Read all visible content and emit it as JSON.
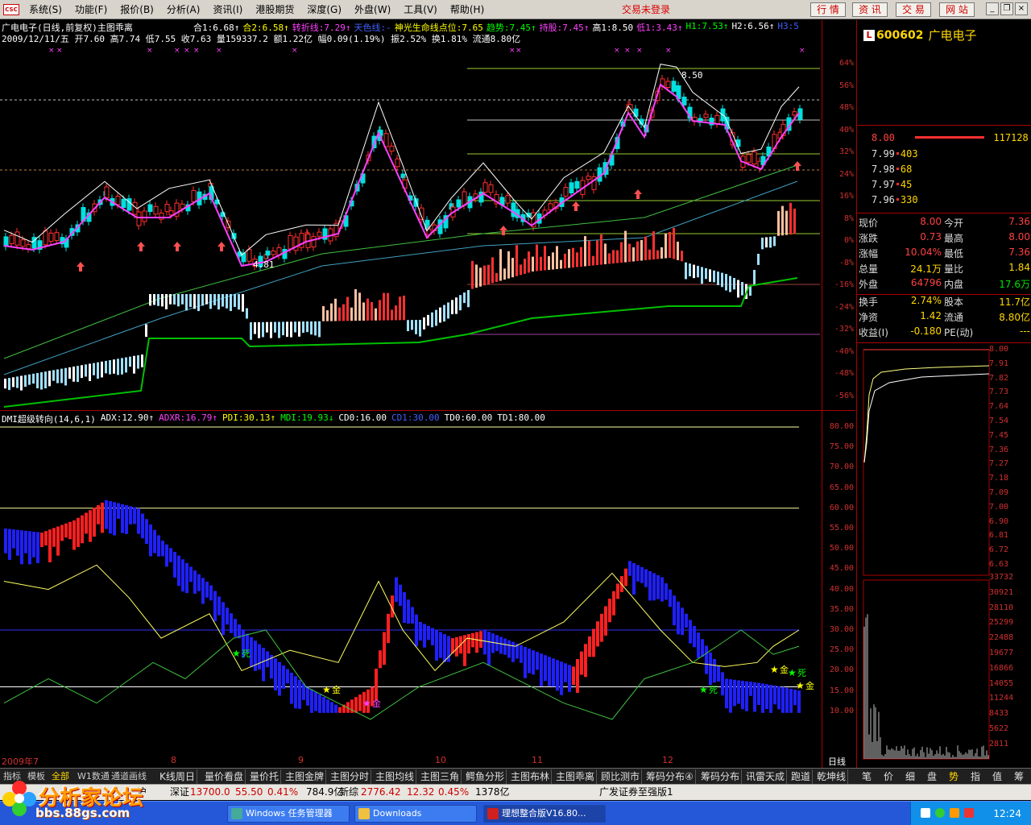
{
  "menubar": {
    "items": [
      "系统(S)",
      "功能(F)",
      "报价(B)",
      "分析(A)",
      "资讯(I)",
      "港股期货",
      "深度(G)",
      "外盘(W)",
      "工具(V)",
      "帮助(H)"
    ],
    "login_status": "交易未登录",
    "tool_buttons": [
      "行 情",
      "资 讯",
      "交 易",
      "网 站"
    ]
  },
  "chart": {
    "title_line": "广电电子(日线,前复权)主图乖离",
    "indicators_main": [
      {
        "text": "合1:6.68↑",
        "color": "#ffffff"
      },
      {
        "text": "合2:6.58↑",
        "color": "#ffff00"
      },
      {
        "text": "转折线:7.29↑",
        "color": "#ff40ff"
      },
      {
        "text": "天色线:-",
        "color": "#4060ff"
      },
      {
        "text": "神光生命线点位:7.65",
        "color": "#ffff00"
      },
      {
        "text": "趋势:7.45↑",
        "color": "#00ff00"
      },
      {
        "text": "持股:7.45↑",
        "color": "#ff40ff"
      },
      {
        "text": "高1:8.50",
        "color": "#ffffff"
      },
      {
        "text": "低1:3.43↑",
        "color": "#ff40ff"
      },
      {
        "text": "H1:7.53↑",
        "color": "#00ff00"
      },
      {
        "text": "H2:6.56↑",
        "color": "#ffffff"
      },
      {
        "text": "H3:5",
        "color": "#4060ff"
      }
    ],
    "date_line": "2009/12/11/五 开7.60 高7.74 低7.55 收7.63 量159337.2 额1.22亿 幅0.09(1.19%) 振2.52% 换1.81% 流通8.80亿",
    "high_label": "8.50",
    "low_label": "4.81",
    "yaxis_upper": [
      "64%",
      "56%",
      "48%",
      "40%",
      "32%",
      "24%",
      "16%",
      "8%",
      "0%",
      "-8%",
      "-16%",
      "-24%",
      "-32%",
      "-40%",
      "-48%",
      "-56%"
    ],
    "dmi_line": [
      {
        "text": "DMI超级转向(14,6,1)",
        "color": "#ffffff"
      },
      {
        "text": "ADX:12.90↑",
        "color": "#ffffff"
      },
      {
        "text": "ADXR:16.79↑",
        "color": "#ff40ff"
      },
      {
        "text": "PDI:30.13↑",
        "color": "#ffff00"
      },
      {
        "text": "MDI:19.93↓",
        "color": "#00ff00"
      },
      {
        "text": "CD0:16.00",
        "color": "#ffffff"
      },
      {
        "text": "CD1:30.00",
        "color": "#4060ff"
      },
      {
        "text": "TD0:60.00",
        "color": "#ffffff"
      },
      {
        "text": "TD1:80.00",
        "color": "#ffffff"
      }
    ],
    "yaxis_lower": [
      "80.00",
      "75.00",
      "70.00",
      "65.00",
      "60.00",
      "55.00",
      "50.00",
      "45.00",
      "40.00",
      "35.00",
      "30.00",
      "25.00",
      "20.00",
      "15.00",
      "10.00"
    ],
    "signals": [
      "死",
      "金",
      "金",
      "死",
      "金",
      "死",
      "金"
    ],
    "xaxis": [
      "2009年7",
      "8",
      "9",
      "10",
      "11",
      "12"
    ],
    "xaxis_unit": "日线"
  },
  "right_panel": {
    "code": "600602",
    "name": "广电电子",
    "badge": "L",
    "sell": {
      "price": "8.00",
      "volume": "117128"
    },
    "buys": [
      {
        "price": "7.99",
        "volume": "403"
      },
      {
        "price": "7.98",
        "volume": "68"
      },
      {
        "price": "7.97",
        "volume": "45"
      },
      {
        "price": "7.96",
        "volume": "330"
      }
    ],
    "stats": [
      {
        "l1": "现价",
        "v1": "8.00",
        "c1": "#ff4040",
        "l2": "今开",
        "v2": "7.36",
        "c2": "#ff4040"
      },
      {
        "l1": "涨跌",
        "v1": "0.73",
        "c1": "#ff4040",
        "l2": "最高",
        "v2": "8.00",
        "c2": "#ff4040"
      },
      {
        "l1": "涨幅",
        "v1": "10.04%",
        "c1": "#ff4040",
        "l2": "最低",
        "v2": "7.36",
        "c2": "#ff4040"
      },
      {
        "l1": "总量",
        "v1": "24.1万",
        "c1": "#ffd700",
        "l2": "量比",
        "v2": "1.84",
        "c2": "#ffd700"
      },
      {
        "l1": "外盘",
        "v1": "64796",
        "c1": "#ff4040",
        "l2": "内盘",
        "v2": "17.6万",
        "c2": "#00e000"
      }
    ],
    "stats2": [
      {
        "l1": "换手",
        "v1": "2.74%",
        "c1": "#ffd700",
        "l2": "股本",
        "v2": "11.7亿",
        "c2": "#ffd700"
      },
      {
        "l1": "净资",
        "v1": "1.42",
        "c1": "#ffd700",
        "l2": "流通",
        "v2": "8.80亿",
        "c2": "#ffd700"
      },
      {
        "l1": "收益(I)",
        "v1": "-0.180",
        "c1": "#ffd700",
        "l2": "PE(动)",
        "v2": "---",
        "c2": "#ffd700"
      }
    ],
    "price_axis": [
      "8.00",
      "7.91",
      "7.82",
      "7.73",
      "7.64",
      "7.54",
      "7.45",
      "7.36",
      "7.27",
      "7.18",
      "7.09",
      "7.00",
      "6.90",
      "6.81",
      "6.72",
      "6.63"
    ],
    "vol_axis": [
      "33732",
      "30921",
      "28110",
      "25299",
      "22488",
      "19677",
      "16866",
      "14055",
      "11244",
      "8433",
      "5622",
      "2811"
    ]
  },
  "tabs": {
    "left": [
      "指标",
      "模板",
      "全部",
      "W1数通",
      "通道画线"
    ],
    "main": [
      "K线周日",
      "量价看盘",
      "量价托",
      "主图金牌",
      "主图分时",
      "主图均线",
      "主图三角",
      "鳄鱼分形",
      "主图布林",
      "主图乖离",
      "顾比测市",
      "筹码分布④",
      "筹码分布",
      "讯雷天成",
      "跑道",
      "乾坤线"
    ],
    "right": [
      "笔",
      "价",
      "细",
      "盘",
      "势",
      "指",
      "值",
      "筹"
    ]
  },
  "indexbar": {
    "hz_label": "沪",
    "sz_label": "深证",
    "sz_value": "13700.0",
    "sz_change": "55.50",
    "sz_pct": "0.41%",
    "sz_amount": "784.9亿",
    "xz_label": "新综",
    "xz_value": "2776.42",
    "xz_change": "12.32",
    "xz_pct": "0.45%",
    "xz_amount": "1378亿",
    "ticker": "广发证券至强版1"
  },
  "taskbar": {
    "tasks": [
      "Windows 任务管理器",
      "Downloads",
      "理想整合版V16.80..."
    ],
    "clock": "12:24"
  },
  "watermark": {
    "line1": "分析家论坛",
    "line2": "bbs.88gs.com"
  }
}
